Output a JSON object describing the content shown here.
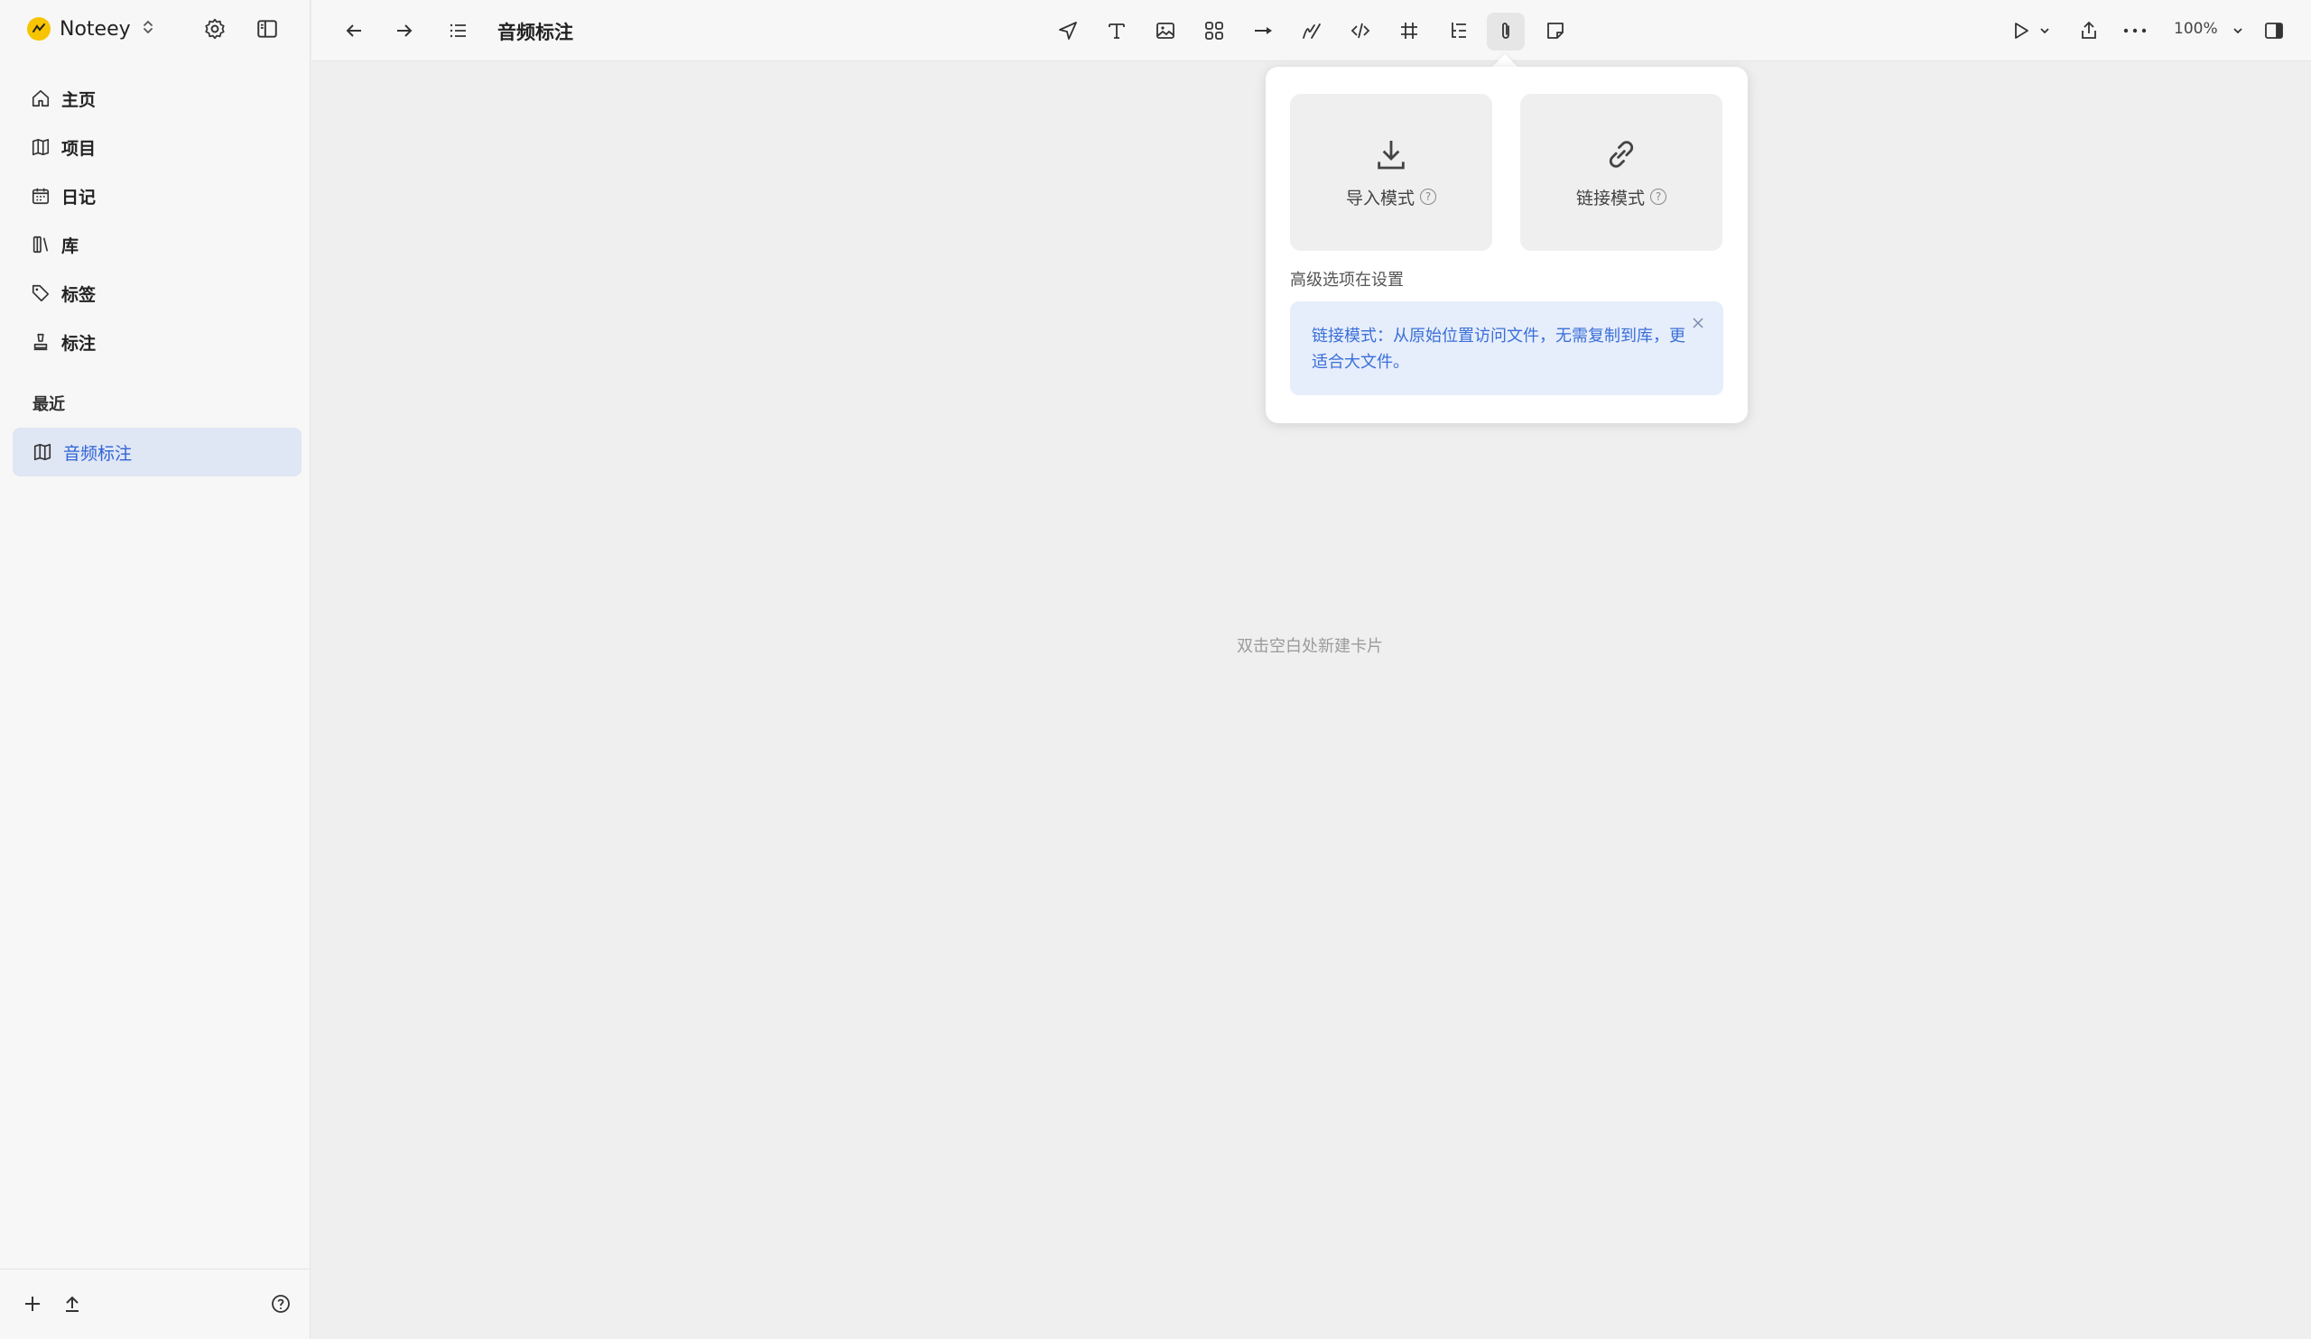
{
  "app": {
    "name": "Noteey"
  },
  "sidebar": {
    "items": [
      {
        "label": "主页",
        "icon": "home-icon"
      },
      {
        "label": "项目",
        "icon": "map-icon"
      },
      {
        "label": "日记",
        "icon": "calendar-icon"
      },
      {
        "label": "库",
        "icon": "library-icon"
      },
      {
        "label": "标签",
        "icon": "tag-icon"
      },
      {
        "label": "标注",
        "icon": "annotation-icon"
      }
    ],
    "recent_label": "最近",
    "recent_items": [
      {
        "label": "音频标注",
        "icon": "map-icon"
      }
    ]
  },
  "toolbar": {
    "page_title": "音频标注",
    "zoom": "100%",
    "tools": [
      "send-icon",
      "text-icon",
      "image-icon",
      "components-icon",
      "arrow-icon",
      "pen-icon",
      "code-icon",
      "frame-icon",
      "outline-icon",
      "attachment-icon",
      "sticky-note-icon"
    ]
  },
  "canvas": {
    "hint": "双击空白处新建卡片"
  },
  "popover": {
    "import_mode": "导入模式",
    "link_mode": "链接模式",
    "help_glyph": "?",
    "advanced_text": "高级选项在设置",
    "info_text": "链接模式：从原始位置访问文件，无需复制到库，更适合大文件。"
  },
  "colors": {
    "accent": "#2f64d8",
    "recent_bg": "#dfe6f4",
    "info_bg": "#e6edfb",
    "brand": "#f7c400"
  }
}
